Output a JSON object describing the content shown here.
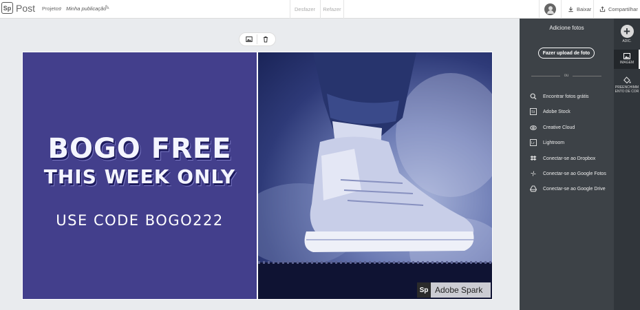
{
  "app": {
    "logo_mark": "Sp",
    "name": "Post"
  },
  "breadcrumb": {
    "root": "Projetos",
    "separator": "›",
    "current": "Minha publicação"
  },
  "history": {
    "undo": "Desfazer",
    "redo": "Refazer"
  },
  "actions": {
    "download": "Baixar",
    "share": "Compartilhar"
  },
  "poster": {
    "headline_1": "BOGO FREE",
    "headline_2": "THIS WEEK ONLY",
    "code_line": "USE CODE BOGO222",
    "background_color": "#433f8c",
    "watermark_mark": "Sp",
    "watermark_text": "Adobe Spark"
  },
  "side_panel": {
    "title": "Adicione fotos",
    "upload_label": "Fazer upload de foto",
    "or_label": "ou",
    "sources": [
      {
        "label": "Encontrar fotos grátis",
        "icon": "search-icon"
      },
      {
        "label": "Adobe Stock",
        "icon": "adobe-stock-icon"
      },
      {
        "label": "Creative Cloud",
        "icon": "creative-cloud-icon"
      },
      {
        "label": "Lightroom",
        "icon": "lightroom-icon"
      },
      {
        "label": "Conectar-se ao Dropbox",
        "icon": "dropbox-icon"
      },
      {
        "label": "Conectar-se ao Google Fotos",
        "icon": "google-photos-icon"
      },
      {
        "label": "Conectar-se ao Google Drive",
        "icon": "google-drive-icon"
      }
    ]
  },
  "rail": {
    "add_label": "ADIC.",
    "image_label": "IMAGEM",
    "fill_label": "PREENCHIMM ENTO DE COR"
  }
}
